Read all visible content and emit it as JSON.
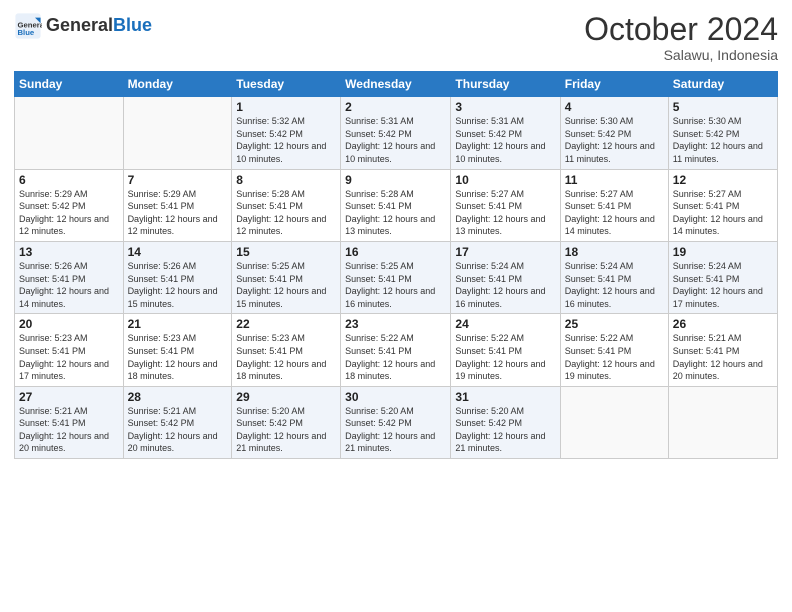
{
  "logo": {
    "text_general": "General",
    "text_blue": "Blue"
  },
  "header": {
    "month": "October 2024",
    "location": "Salawu, Indonesia"
  },
  "days_of_week": [
    "Sunday",
    "Monday",
    "Tuesday",
    "Wednesday",
    "Thursday",
    "Friday",
    "Saturday"
  ],
  "weeks": [
    [
      {
        "day": "",
        "sunrise": "",
        "sunset": "",
        "daylight": ""
      },
      {
        "day": "",
        "sunrise": "",
        "sunset": "",
        "daylight": ""
      },
      {
        "day": "1",
        "sunrise": "Sunrise: 5:32 AM",
        "sunset": "Sunset: 5:42 PM",
        "daylight": "Daylight: 12 hours and 10 minutes."
      },
      {
        "day": "2",
        "sunrise": "Sunrise: 5:31 AM",
        "sunset": "Sunset: 5:42 PM",
        "daylight": "Daylight: 12 hours and 10 minutes."
      },
      {
        "day": "3",
        "sunrise": "Sunrise: 5:31 AM",
        "sunset": "Sunset: 5:42 PM",
        "daylight": "Daylight: 12 hours and 10 minutes."
      },
      {
        "day": "4",
        "sunrise": "Sunrise: 5:30 AM",
        "sunset": "Sunset: 5:42 PM",
        "daylight": "Daylight: 12 hours and 11 minutes."
      },
      {
        "day": "5",
        "sunrise": "Sunrise: 5:30 AM",
        "sunset": "Sunset: 5:42 PM",
        "daylight": "Daylight: 12 hours and 11 minutes."
      }
    ],
    [
      {
        "day": "6",
        "sunrise": "Sunrise: 5:29 AM",
        "sunset": "Sunset: 5:42 PM",
        "daylight": "Daylight: 12 hours and 12 minutes."
      },
      {
        "day": "7",
        "sunrise": "Sunrise: 5:29 AM",
        "sunset": "Sunset: 5:41 PM",
        "daylight": "Daylight: 12 hours and 12 minutes."
      },
      {
        "day": "8",
        "sunrise": "Sunrise: 5:28 AM",
        "sunset": "Sunset: 5:41 PM",
        "daylight": "Daylight: 12 hours and 12 minutes."
      },
      {
        "day": "9",
        "sunrise": "Sunrise: 5:28 AM",
        "sunset": "Sunset: 5:41 PM",
        "daylight": "Daylight: 12 hours and 13 minutes."
      },
      {
        "day": "10",
        "sunrise": "Sunrise: 5:27 AM",
        "sunset": "Sunset: 5:41 PM",
        "daylight": "Daylight: 12 hours and 13 minutes."
      },
      {
        "day": "11",
        "sunrise": "Sunrise: 5:27 AM",
        "sunset": "Sunset: 5:41 PM",
        "daylight": "Daylight: 12 hours and 14 minutes."
      },
      {
        "day": "12",
        "sunrise": "Sunrise: 5:27 AM",
        "sunset": "Sunset: 5:41 PM",
        "daylight": "Daylight: 12 hours and 14 minutes."
      }
    ],
    [
      {
        "day": "13",
        "sunrise": "Sunrise: 5:26 AM",
        "sunset": "Sunset: 5:41 PM",
        "daylight": "Daylight: 12 hours and 14 minutes."
      },
      {
        "day": "14",
        "sunrise": "Sunrise: 5:26 AM",
        "sunset": "Sunset: 5:41 PM",
        "daylight": "Daylight: 12 hours and 15 minutes."
      },
      {
        "day": "15",
        "sunrise": "Sunrise: 5:25 AM",
        "sunset": "Sunset: 5:41 PM",
        "daylight": "Daylight: 12 hours and 15 minutes."
      },
      {
        "day": "16",
        "sunrise": "Sunrise: 5:25 AM",
        "sunset": "Sunset: 5:41 PM",
        "daylight": "Daylight: 12 hours and 16 minutes."
      },
      {
        "day": "17",
        "sunrise": "Sunrise: 5:24 AM",
        "sunset": "Sunset: 5:41 PM",
        "daylight": "Daylight: 12 hours and 16 minutes."
      },
      {
        "day": "18",
        "sunrise": "Sunrise: 5:24 AM",
        "sunset": "Sunset: 5:41 PM",
        "daylight": "Daylight: 12 hours and 16 minutes."
      },
      {
        "day": "19",
        "sunrise": "Sunrise: 5:24 AM",
        "sunset": "Sunset: 5:41 PM",
        "daylight": "Daylight: 12 hours and 17 minutes."
      }
    ],
    [
      {
        "day": "20",
        "sunrise": "Sunrise: 5:23 AM",
        "sunset": "Sunset: 5:41 PM",
        "daylight": "Daylight: 12 hours and 17 minutes."
      },
      {
        "day": "21",
        "sunrise": "Sunrise: 5:23 AM",
        "sunset": "Sunset: 5:41 PM",
        "daylight": "Daylight: 12 hours and 18 minutes."
      },
      {
        "day": "22",
        "sunrise": "Sunrise: 5:23 AM",
        "sunset": "Sunset: 5:41 PM",
        "daylight": "Daylight: 12 hours and 18 minutes."
      },
      {
        "day": "23",
        "sunrise": "Sunrise: 5:22 AM",
        "sunset": "Sunset: 5:41 PM",
        "daylight": "Daylight: 12 hours and 18 minutes."
      },
      {
        "day": "24",
        "sunrise": "Sunrise: 5:22 AM",
        "sunset": "Sunset: 5:41 PM",
        "daylight": "Daylight: 12 hours and 19 minutes."
      },
      {
        "day": "25",
        "sunrise": "Sunrise: 5:22 AM",
        "sunset": "Sunset: 5:41 PM",
        "daylight": "Daylight: 12 hours and 19 minutes."
      },
      {
        "day": "26",
        "sunrise": "Sunrise: 5:21 AM",
        "sunset": "Sunset: 5:41 PM",
        "daylight": "Daylight: 12 hours and 20 minutes."
      }
    ],
    [
      {
        "day": "27",
        "sunrise": "Sunrise: 5:21 AM",
        "sunset": "Sunset: 5:41 PM",
        "daylight": "Daylight: 12 hours and 20 minutes."
      },
      {
        "day": "28",
        "sunrise": "Sunrise: 5:21 AM",
        "sunset": "Sunset: 5:42 PM",
        "daylight": "Daylight: 12 hours and 20 minutes."
      },
      {
        "day": "29",
        "sunrise": "Sunrise: 5:20 AM",
        "sunset": "Sunset: 5:42 PM",
        "daylight": "Daylight: 12 hours and 21 minutes."
      },
      {
        "day": "30",
        "sunrise": "Sunrise: 5:20 AM",
        "sunset": "Sunset: 5:42 PM",
        "daylight": "Daylight: 12 hours and 21 minutes."
      },
      {
        "day": "31",
        "sunrise": "Sunrise: 5:20 AM",
        "sunset": "Sunset: 5:42 PM",
        "daylight": "Daylight: 12 hours and 21 minutes."
      },
      {
        "day": "",
        "sunrise": "",
        "sunset": "",
        "daylight": ""
      },
      {
        "day": "",
        "sunrise": "",
        "sunset": "",
        "daylight": ""
      }
    ]
  ]
}
